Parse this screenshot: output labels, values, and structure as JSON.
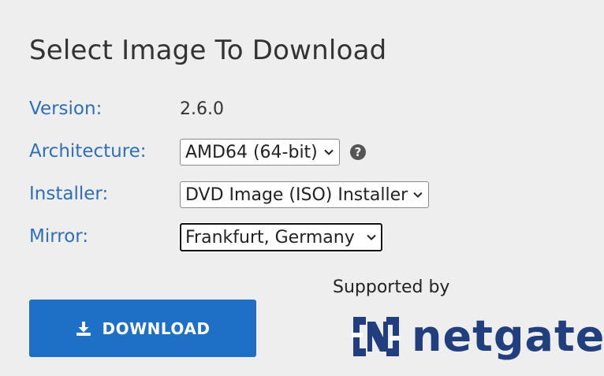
{
  "heading": "Select Image To Download",
  "version": {
    "label": "Version:",
    "value": "2.6.0"
  },
  "architecture": {
    "label": "Architecture:",
    "selected": "AMD64 (64-bit)",
    "help_icon": "question-circle-icon"
  },
  "installer": {
    "label": "Installer:",
    "selected": "DVD Image (ISO) Installer"
  },
  "mirror": {
    "label": "Mirror:",
    "selected": "Frankfurt, Germany"
  },
  "download_button": {
    "label": "DOWNLOAD",
    "icon": "download-icon"
  },
  "sponsor": {
    "text": "Supported by",
    "logo_text": "netgate",
    "logo_icon": "netgate-logo-icon"
  },
  "colors": {
    "label": "#2f6fb8",
    "button": "#1e6fc6",
    "logo": "#213f7e",
    "background": "#eeeeee"
  }
}
